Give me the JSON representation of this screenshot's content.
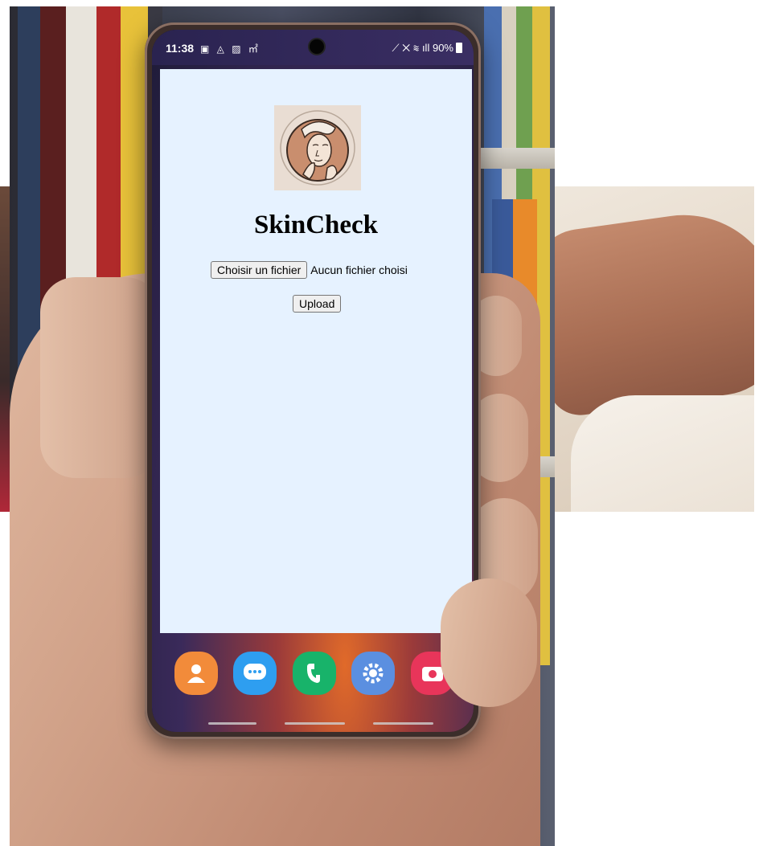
{
  "status_bar": {
    "time": "11:38",
    "battery": "90%"
  },
  "app": {
    "title": "SkinCheck",
    "logo_icon": "face-illustration-icon",
    "file_button_label": "Choisir un fichier",
    "file_status": "Aucun fichier choisi",
    "upload_label": "Upload",
    "background_color": "#e6f2ff"
  },
  "dock": [
    {
      "name": "contacts-icon",
      "color": "#f28b3a"
    },
    {
      "name": "messages-icon",
      "color": "#2e9ef0"
    },
    {
      "name": "phone-icon",
      "color": "#18b36a"
    },
    {
      "name": "settings-icon",
      "color": "#5b8fe0"
    },
    {
      "name": "camera-icon",
      "color": "#e8355a"
    }
  ]
}
